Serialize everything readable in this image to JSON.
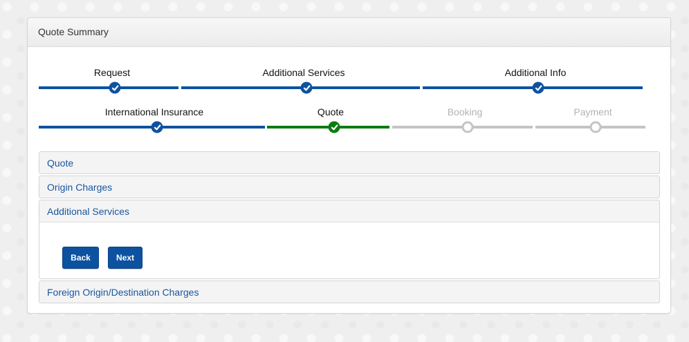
{
  "panel": {
    "title": "Quote Summary"
  },
  "wizard": {
    "steps": [
      {
        "label": "Request",
        "state": "done"
      },
      {
        "label": "Additional Services",
        "state": "done"
      },
      {
        "label": "Additional Info",
        "state": "done"
      },
      {
        "label": "International Insurance",
        "state": "done"
      },
      {
        "label": "Quote",
        "state": "current"
      },
      {
        "label": "Booking",
        "state": "pending"
      },
      {
        "label": "Payment",
        "state": "pending"
      }
    ]
  },
  "accordion": {
    "sections": [
      {
        "title": "Quote",
        "expanded": false
      },
      {
        "title": "Origin Charges",
        "expanded": false
      },
      {
        "title": "Additional Services",
        "expanded": true
      },
      {
        "title": "Foreign Origin/Destination Charges",
        "expanded": false
      }
    ],
    "back_label": "Back",
    "next_label": "Next"
  },
  "colors": {
    "done": "#0d52a0",
    "current": "#0b7d10",
    "pending": "#c4c4c4",
    "link": "#1a55a0"
  }
}
